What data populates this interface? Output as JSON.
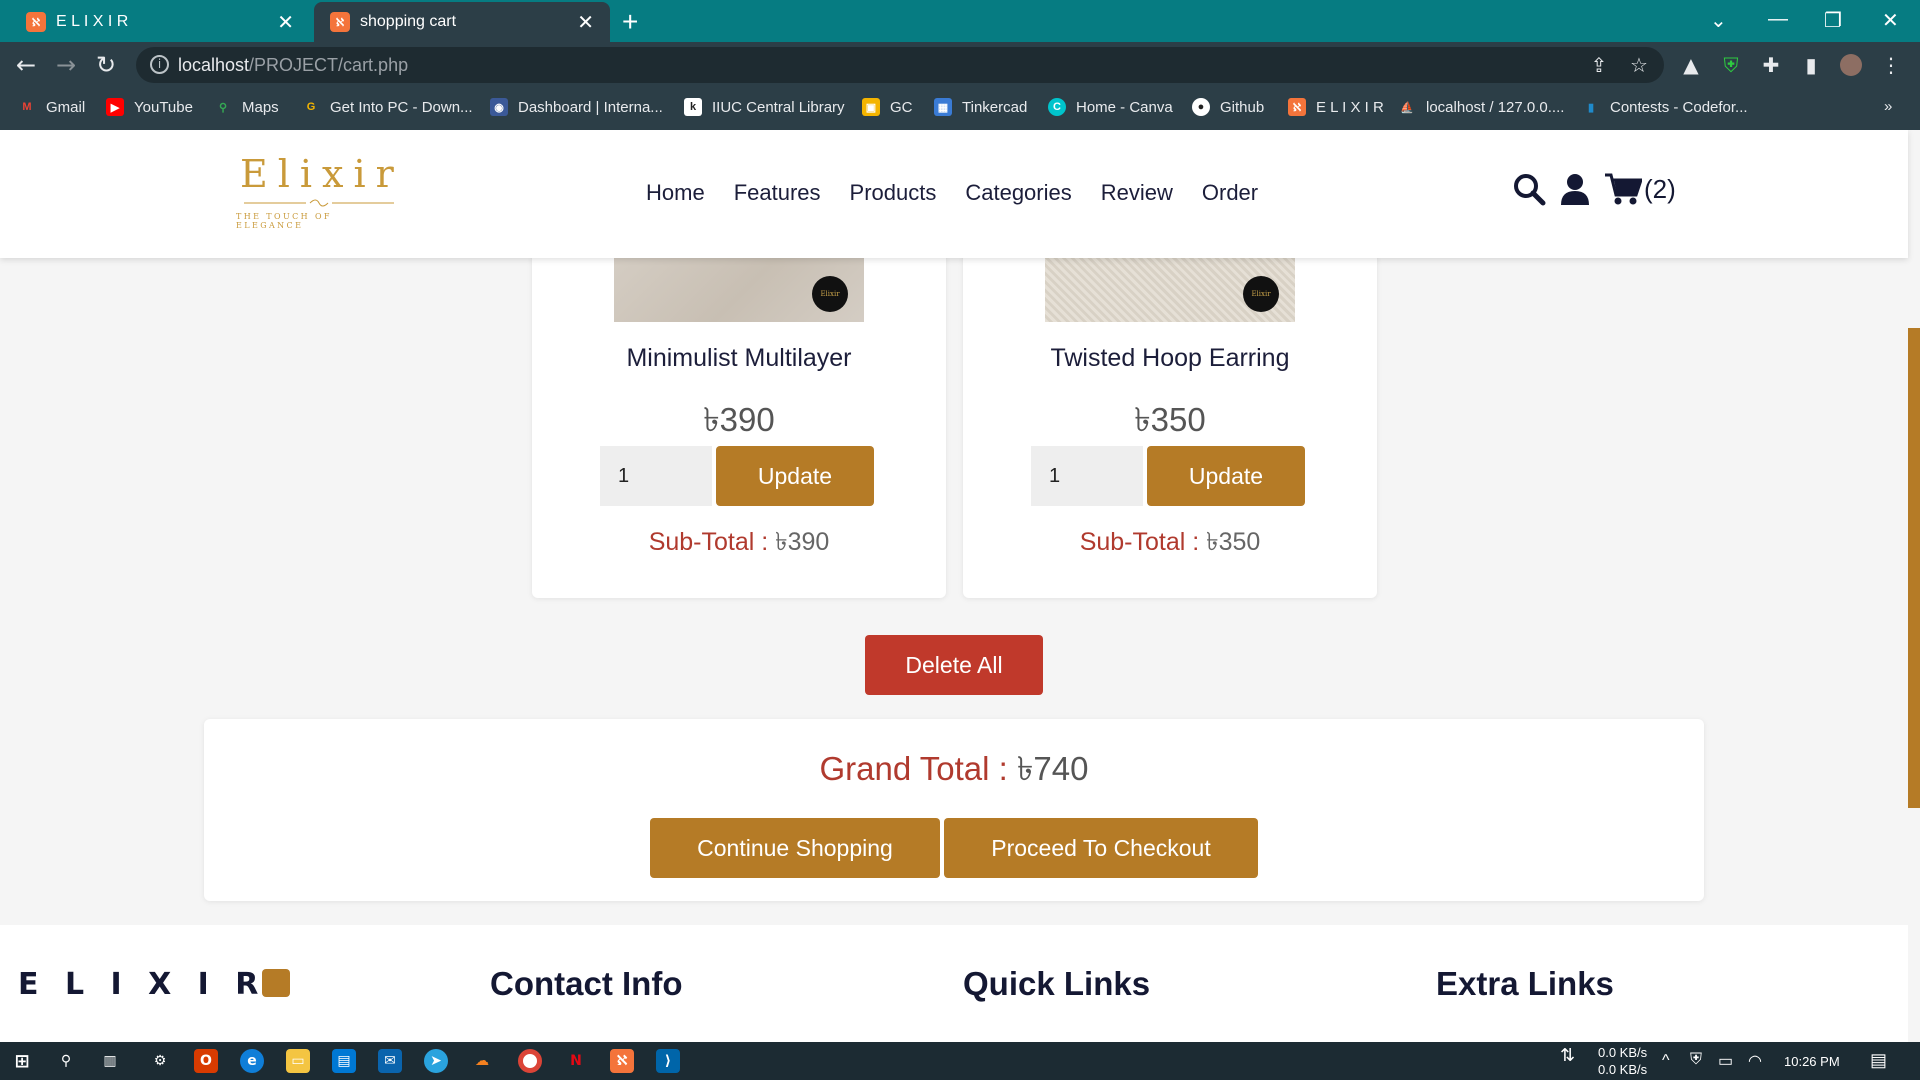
{
  "browser": {
    "tabs": [
      {
        "title": "E L I X I R",
        "active": false
      },
      {
        "title": "shopping cart",
        "active": true
      }
    ],
    "url_host": "localhost",
    "url_path": "/PROJECT/cart.php",
    "bookmarks": [
      {
        "label": "Gmail",
        "icon": "gmail-icon",
        "color": "#ea4335"
      },
      {
        "label": "YouTube",
        "icon": "youtube-icon",
        "color": "#ff0000"
      },
      {
        "label": "Maps",
        "icon": "maps-icon",
        "color": "#34a853"
      },
      {
        "label": "Get Into PC - Down...",
        "icon": "getintopc-icon",
        "color": "#f4b400"
      },
      {
        "label": "Dashboard | Interna...",
        "icon": "dashboard-icon",
        "color": "#3b5998"
      },
      {
        "label": "IIUC Central Library",
        "icon": "library-icon",
        "color": "#ffffff"
      },
      {
        "label": "GC",
        "icon": "classroom-icon",
        "color": "#f4b400"
      },
      {
        "label": "Tinkercad",
        "icon": "tinkercad-icon",
        "color": "#3a7bd5"
      },
      {
        "label": "Home - Canva",
        "icon": "canva-icon",
        "color": "#00c4cc"
      },
      {
        "label": "Github",
        "icon": "github-icon",
        "color": "#ffffff"
      },
      {
        "label": "E L I X I R",
        "icon": "xampp-icon",
        "color": "#f4743b"
      },
      {
        "label": "localhost / 127.0.0....",
        "icon": "phpmyadmin-icon",
        "color": "#f89c0e"
      },
      {
        "label": "Contests - Codefor...",
        "icon": "codeforces-icon",
        "color": "#1f8acb"
      }
    ],
    "more_bookmarks": "»"
  },
  "header": {
    "logo_word": "Elixir",
    "logo_tagline": "THE TOUCH OF ELEGANCE",
    "nav": [
      "Home",
      "Features",
      "Products",
      "Categories",
      "Review",
      "Order"
    ],
    "cart_count": "(2)"
  },
  "cart": {
    "items": [
      {
        "name": "Minimulist Multilayer",
        "price": "৳390",
        "qty": "1",
        "update_label": "Update",
        "subtotal_label": "Sub-Total : ",
        "subtotal_value": "৳390"
      },
      {
        "name": "Twisted Hoop Earring",
        "price": "৳350",
        "qty": "1",
        "update_label": "Update",
        "subtotal_label": "Sub-Total : ",
        "subtotal_value": "৳350"
      }
    ],
    "badge_text": "Elixir",
    "delete_all_label": "Delete All",
    "grand_total_label": "Grand Total : ",
    "grand_total_value": "৳740",
    "continue_label": "Continue Shopping",
    "checkout_label": "Proceed To Checkout"
  },
  "footer": {
    "brand": "E L I X I R",
    "columns": [
      "Contact Info",
      "Quick Links",
      "Extra Links"
    ]
  },
  "taskbar": {
    "net_down": "0.0 KB/s",
    "net_up": "0.0 KB/s",
    "time": "10:26 PM"
  },
  "colors": {
    "accent_brown": "#b57b26",
    "danger_red": "#c0392b",
    "subtotal_red": "#b03a2e",
    "tab_teal": "#067c82",
    "navy_text": "#1c1e3a"
  }
}
